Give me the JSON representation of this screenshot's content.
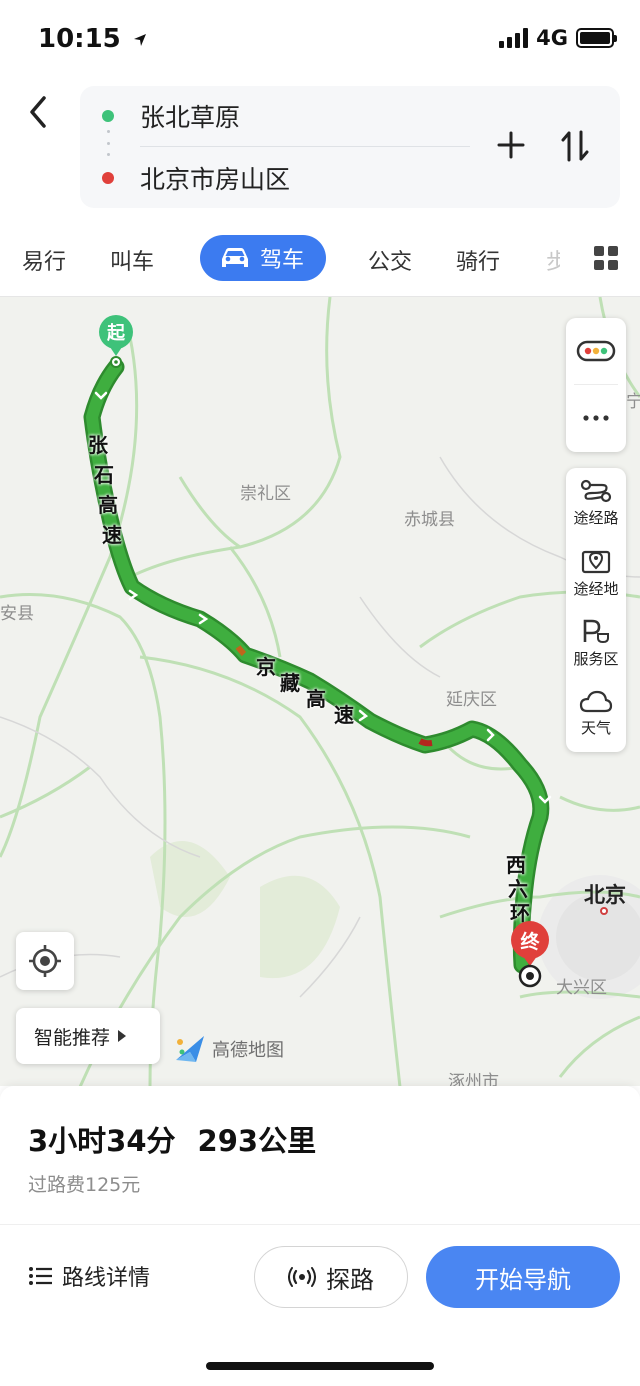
{
  "status": {
    "time": "10:15",
    "network": "4G"
  },
  "route": {
    "from": "张北草原",
    "to": "北京市房山区",
    "from_color": "#3ec27a",
    "to_color": "#e0403b"
  },
  "modes": [
    {
      "label": "易行"
    },
    {
      "label": "叫车"
    },
    {
      "label": "驾车",
      "active": true
    },
    {
      "label": "公交"
    },
    {
      "label": "骑行"
    },
    {
      "label": "步"
    }
  ],
  "map": {
    "labels": {
      "chongli": "崇礼区",
      "chicheng": "赤城县",
      "anxian": "安县",
      "yanqing": "延庆区",
      "beijing": "北京",
      "daxing": "大兴区",
      "zhuozhou": "涿州市",
      "ning": "宁"
    },
    "road_zhangshi": [
      "张",
      "石",
      "高",
      "速"
    ],
    "road_jingzang": [
      "京",
      "藏",
      "高",
      "速"
    ],
    "road_xiliuhuan": [
      "西",
      "六",
      "环"
    ],
    "start_marker": "起",
    "end_marker": "终",
    "route_color": "#36a436",
    "road_color": "#b9dcb0"
  },
  "side_tools": [
    {
      "label": "途经路",
      "icon": "waypoint-road-icon"
    },
    {
      "label": "途经地",
      "icon": "waypoint-place-icon"
    },
    {
      "label": "服务区",
      "icon": "service-area-icon"
    },
    {
      "label": "天气",
      "icon": "weather-cloud-icon"
    }
  ],
  "smart_recommend": "智能推荐",
  "logo_text": "高德地图",
  "summary": {
    "duration": "3小时34分",
    "distance": "293公里",
    "toll": "过路费125元"
  },
  "actions": {
    "details": "路线详情",
    "explore": "探路",
    "start_nav": "开始导航"
  },
  "accent_color": "#3c7bf0"
}
